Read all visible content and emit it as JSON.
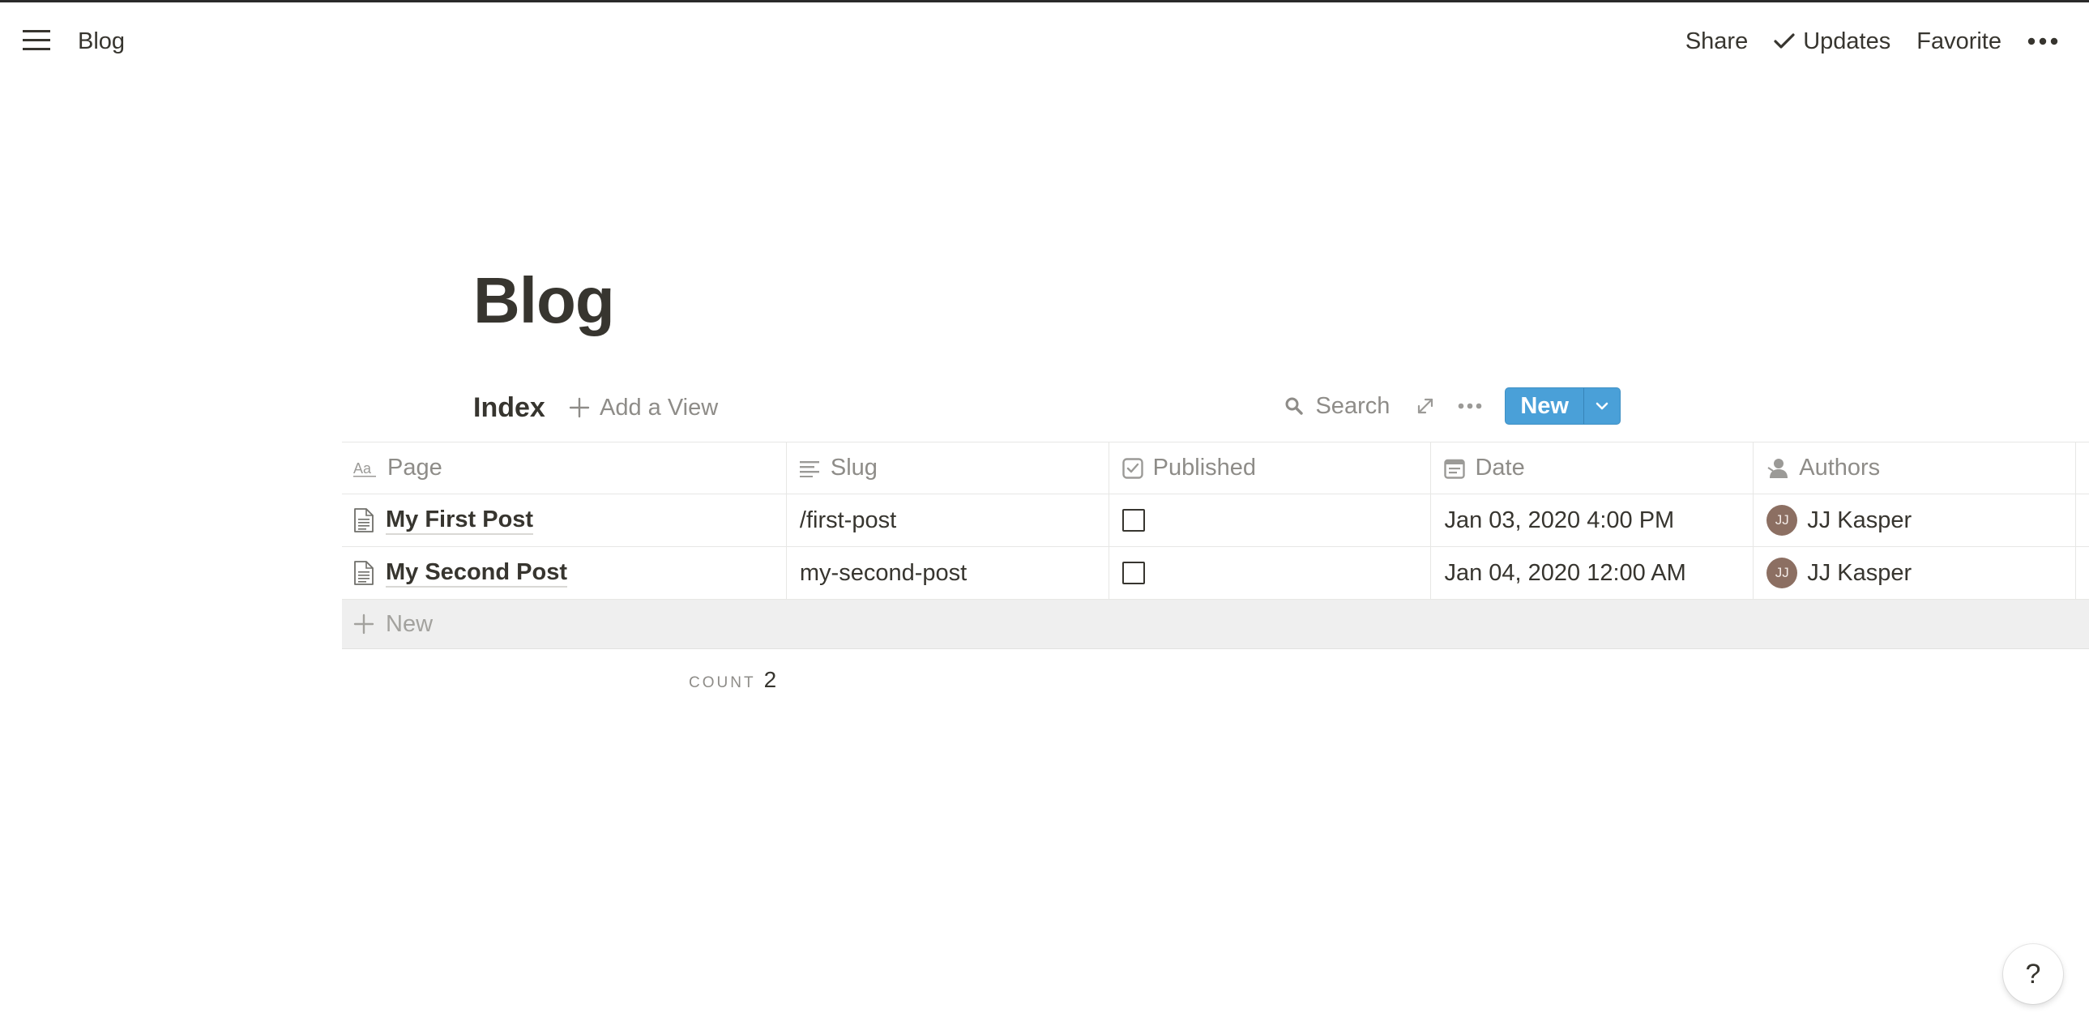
{
  "topbar": {
    "title": "Blog",
    "share_label": "Share",
    "updates_label": "Updates",
    "favorite_label": "Favorite"
  },
  "page": {
    "title": "Blog"
  },
  "view": {
    "name": "Index",
    "add_view_label": "Add a View",
    "search_label": "Search",
    "new_label": "New"
  },
  "table": {
    "columns": [
      {
        "label": "Page",
        "icon": "title-icon"
      },
      {
        "label": "Slug",
        "icon": "text-icon"
      },
      {
        "label": "Published",
        "icon": "checkbox-icon"
      },
      {
        "label": "Date",
        "icon": "calendar-icon"
      },
      {
        "label": "Authors",
        "icon": "person-icon"
      }
    ],
    "rows": [
      {
        "page": "My First Post",
        "slug": "/first-post",
        "published": false,
        "date": "Jan 03, 2020 4:00 PM",
        "author_initials": "JJ",
        "author": "JJ Kasper"
      },
      {
        "page": "My Second Post",
        "slug": "my-second-post",
        "published": false,
        "date": "Jan 04, 2020 12:00 AM",
        "author_initials": "JJ",
        "author": "JJ Kasper"
      }
    ],
    "new_row_label": "New",
    "count_label": "COUNT",
    "count_value": "2"
  },
  "help": {
    "label": "?"
  },
  "colors": {
    "accent": "#4aa0d8",
    "text": "#37352f",
    "muted": "#8e8c88",
    "avatar": "#8c6f62"
  }
}
